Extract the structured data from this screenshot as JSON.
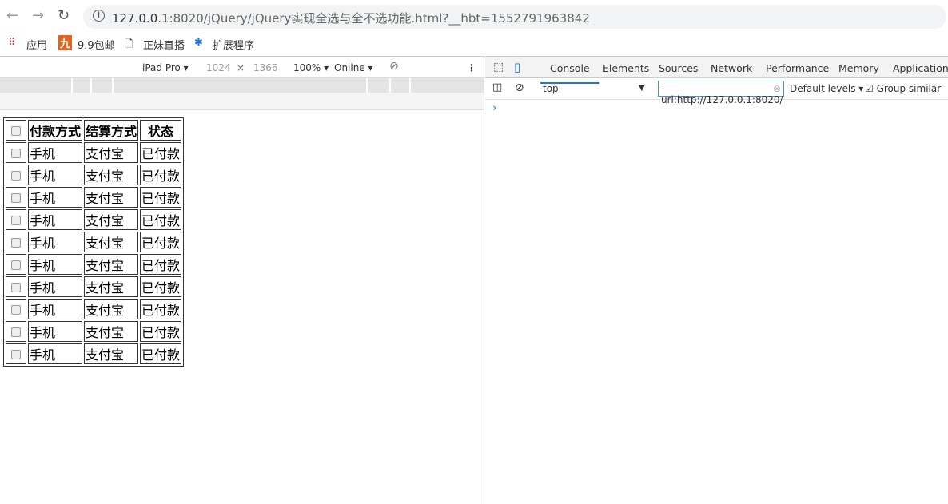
{
  "browser": {
    "url_host": "127.0.0.1",
    "url_rest": ":8020/jQuery/jQuery实现全选与全不选功能.html?__hbt=1552791963842",
    "bookmarks": [
      {
        "label": "应用",
        "icon": "apps-grid-icon"
      },
      {
        "label": "9.9包邮",
        "icon": "jiu-logo-icon"
      },
      {
        "label": "正妹直播",
        "icon": "page-icon"
      },
      {
        "label": "扩展程序",
        "icon": "puzzle-icon"
      }
    ]
  },
  "device_toolbar": {
    "device": "iPad Pro",
    "width": "1024",
    "x": "×",
    "height": "1366",
    "zoom": "100%",
    "network": "Online"
  },
  "table": {
    "headers": [
      "付款方式",
      "结算方式",
      "状态"
    ],
    "rows": [
      [
        "手机",
        "支付宝",
        "已付款"
      ],
      [
        "手机",
        "支付宝",
        "已付款"
      ],
      [
        "手机",
        "支付宝",
        "已付款"
      ],
      [
        "手机",
        "支付宝",
        "已付款"
      ],
      [
        "手机",
        "支付宝",
        "已付款"
      ],
      [
        "手机",
        "支付宝",
        "已付款"
      ],
      [
        "手机",
        "支付宝",
        "已付款"
      ],
      [
        "手机",
        "支付宝",
        "已付款"
      ],
      [
        "手机",
        "支付宝",
        "已付款"
      ],
      [
        "手机",
        "支付宝",
        "已付款"
      ]
    ]
  },
  "devtools": {
    "tabs": [
      "Console",
      "Elements",
      "Sources",
      "Network",
      "Performance",
      "Memory",
      "Application"
    ],
    "active_tab": "Console",
    "context": "top",
    "filter": "-url:http://127.0.0.1:8020/",
    "levels": "Default levels",
    "group_similar": "Group similar",
    "group_similar_checked": true,
    "prompt": "›"
  }
}
